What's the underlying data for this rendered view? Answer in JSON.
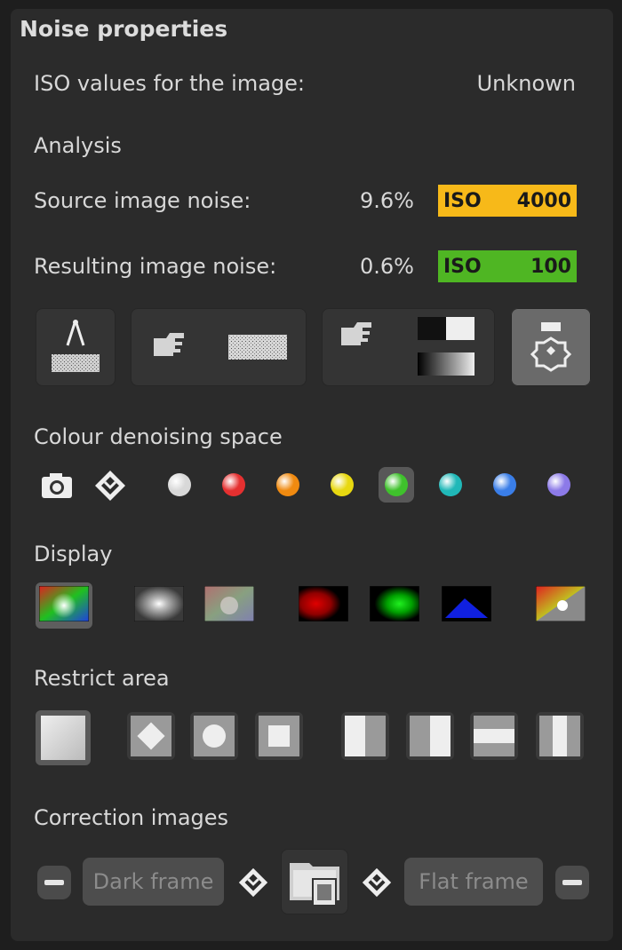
{
  "panel": {
    "title": "Noise properties",
    "iso_row": {
      "label": "ISO values for the image:",
      "value": "Unknown"
    },
    "analysis": {
      "heading": "Analysis",
      "source": {
        "label": "Source image noise:",
        "percent": "9.6%",
        "badge_iso": "ISO",
        "badge_value": "4000",
        "badge_color": "#f7b919"
      },
      "result": {
        "label": "Resulting image noise:",
        "percent": "0.6%",
        "badge_iso": "ISO",
        "badge_value": "100",
        "badge_color": "#4fb623"
      }
    },
    "toolbar": {
      "items": [
        {
          "name": "measure-noise-icon"
        },
        {
          "name": "pick-noise-sample-icon"
        },
        {
          "name": "pick-black-white-icon"
        },
        {
          "name": "auto-settings-icon"
        }
      ]
    },
    "colour_space": {
      "heading": "Colour denoising space",
      "swatches": [
        {
          "name": "grey",
          "color": "#d8d8d8"
        },
        {
          "name": "red",
          "color": "#e53030"
        },
        {
          "name": "orange",
          "color": "#f08a10"
        },
        {
          "name": "yellow",
          "color": "#e8d810"
        },
        {
          "name": "green",
          "color": "#3fc22c"
        },
        {
          "name": "cyan",
          "color": "#20b8b8"
        },
        {
          "name": "blue",
          "color": "#3a7ee8"
        },
        {
          "name": "violet",
          "color": "#8c7ae8"
        }
      ],
      "selected": "green"
    },
    "display": {
      "heading": "Display"
    },
    "restrict": {
      "heading": "Restrict area"
    },
    "correction": {
      "heading": "Correction images",
      "dark_frame": "Dark frame",
      "flat_frame": "Flat frame"
    }
  }
}
